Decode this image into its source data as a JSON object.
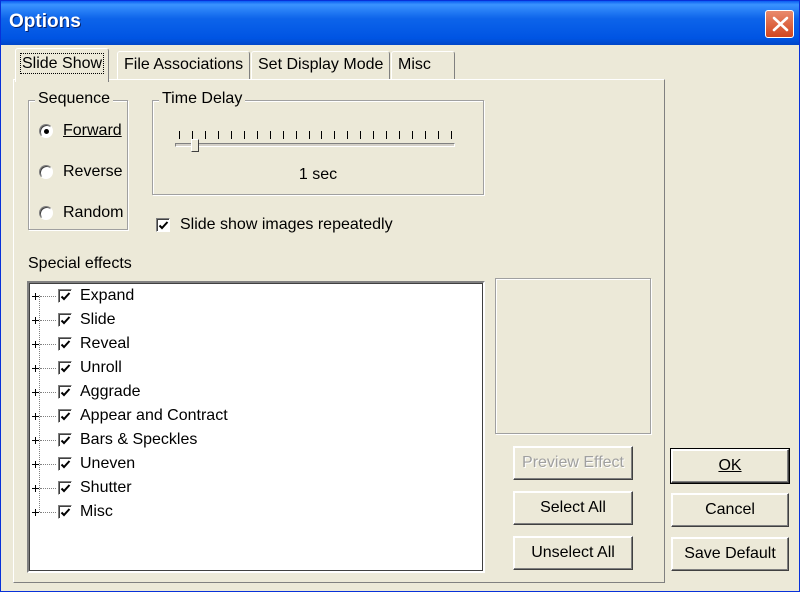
{
  "window": {
    "title": "Options"
  },
  "tabs": [
    {
      "label": "Slide Show",
      "active": true
    },
    {
      "label": "File Associations",
      "active": false
    },
    {
      "label": "Set Display Mode",
      "active": false
    },
    {
      "label": "Misc",
      "active": false
    }
  ],
  "sequence": {
    "title": "Sequence",
    "options": [
      {
        "label": "Forward",
        "selected": true
      },
      {
        "label": "Reverse",
        "selected": false
      },
      {
        "label": "Random",
        "selected": false
      }
    ]
  },
  "time_delay": {
    "title": "Time Delay",
    "value_label": "1 sec",
    "tick_count": 22,
    "slider_position": 1
  },
  "repeat": {
    "label": "Slide show images repeatedly",
    "checked": true
  },
  "special_effects": {
    "label": "Special effects",
    "items": [
      {
        "label": "Expand",
        "checked": true
      },
      {
        "label": "Slide",
        "checked": true
      },
      {
        "label": "Reveal",
        "checked": true
      },
      {
        "label": "Unroll",
        "checked": true
      },
      {
        "label": "Aggrade",
        "checked": true
      },
      {
        "label": "Appear and Contract",
        "checked": true
      },
      {
        "label": "Bars & Speckles",
        "checked": true
      },
      {
        "label": "Uneven",
        "checked": true
      },
      {
        "label": "Shutter",
        "checked": true
      },
      {
        "label": "Misc",
        "checked": true
      }
    ]
  },
  "buttons": {
    "preview": "Preview Effect",
    "select_all": "Select All",
    "unselect_all": "Unselect All",
    "ok": "OK",
    "cancel": "Cancel",
    "save_default": "Save Default"
  },
  "colors": {
    "titlebar": "#0054e3",
    "window_bg": "#ece9d8",
    "close_button": "#d2451e"
  }
}
